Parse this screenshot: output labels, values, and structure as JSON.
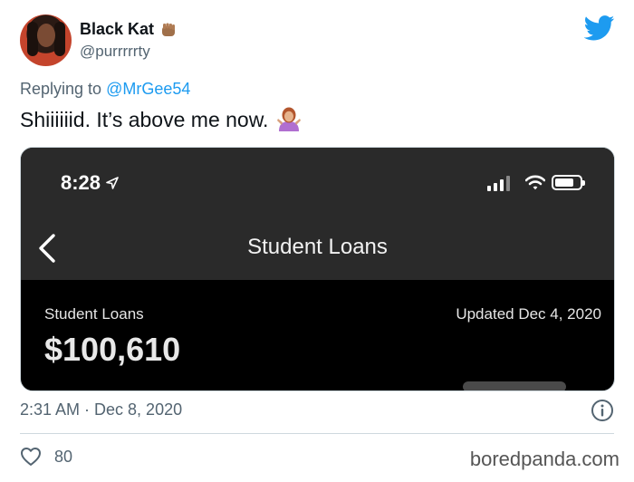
{
  "author": {
    "name": "Black Kat",
    "handle": "@purrrrrty"
  },
  "reply": {
    "prefix": "Replying to",
    "mention": "@MrGee54"
  },
  "tweet": {
    "text": "Shiiiiiid. It’s above me now."
  },
  "screenshot": {
    "time": "8:28",
    "screen_title": "Student Loans",
    "account_label": "Student Loans",
    "updated": "Updated Dec 4, 2020",
    "amount": "$100,610"
  },
  "meta": {
    "timestamp": "2:31 AM · Dec 8, 2020"
  },
  "engagement": {
    "likes": "80"
  },
  "watermark": "boredpanda.com",
  "icons": [
    "fist-emoji-icon",
    "twitter-bird-icon",
    "shrug-emoji-icon",
    "location-arrow-icon",
    "signal-icon",
    "wifi-icon",
    "battery-icon",
    "back-chevron-icon",
    "info-icon",
    "heart-icon"
  ],
  "colors": {
    "accent": "#1d9bf0",
    "muted": "#536471",
    "text": "#0f1419",
    "phone_header": "#2a2a2a"
  }
}
